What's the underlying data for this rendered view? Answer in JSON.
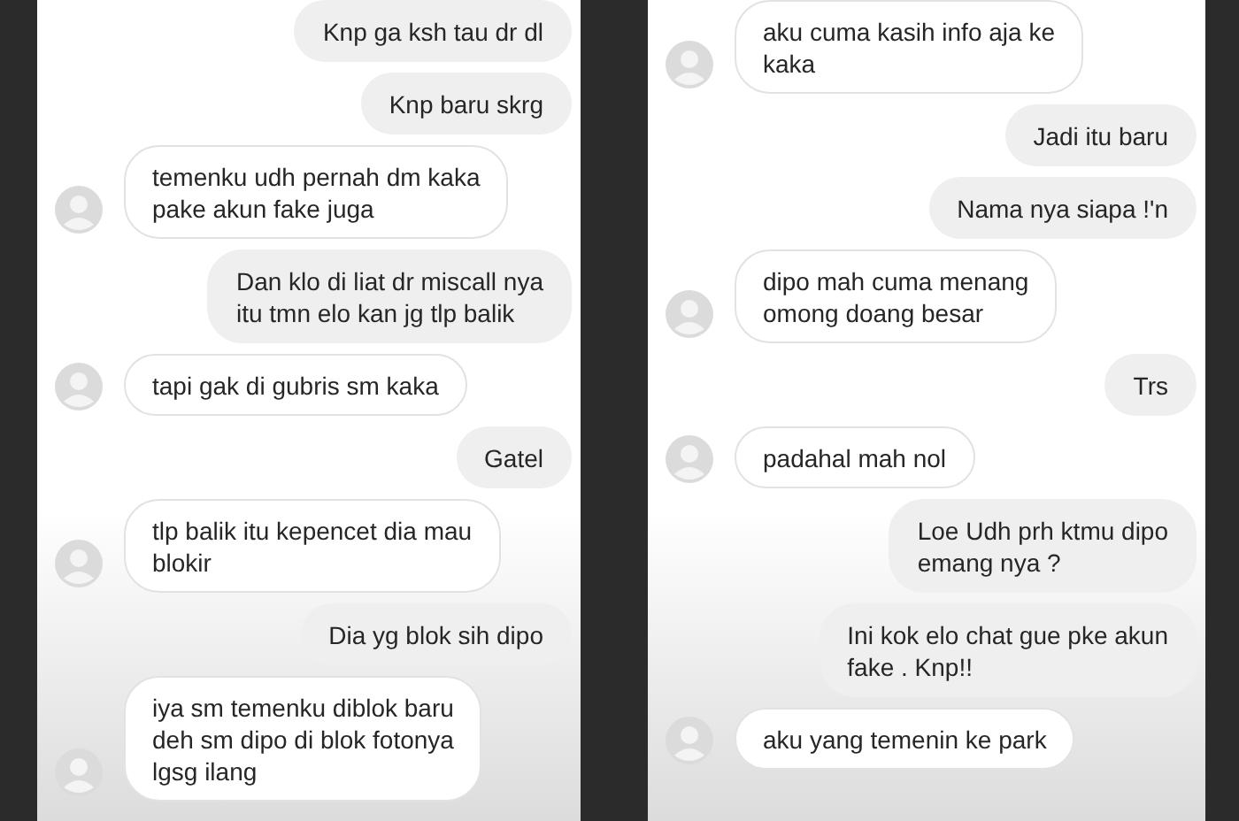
{
  "panels": [
    {
      "messages": [
        {
          "kind": "outgoing",
          "text": "Knp ga ksh tau dr dl"
        },
        {
          "kind": "outgoing",
          "text": "Knp baru skrg"
        },
        {
          "kind": "incoming",
          "text": "temenku udh pernah dm kaka\npake akun fake juga"
        },
        {
          "kind": "outgoing",
          "text": "Dan klo di liat dr miscall nya\nitu tmn elo kan jg tlp balik"
        },
        {
          "kind": "incoming",
          "text": "tapi gak di gubris sm kaka"
        },
        {
          "kind": "outgoing",
          "text": "Gatel"
        },
        {
          "kind": "incoming",
          "text": "tlp balik itu kepencet dia mau\nblokir"
        },
        {
          "kind": "outgoing",
          "text": "Dia yg blok sih dipo"
        },
        {
          "kind": "incoming",
          "text": "iya sm temenku diblok baru\ndeh sm dipo di blok fotonya\nlgsg ilang"
        }
      ]
    },
    {
      "messages": [
        {
          "kind": "incoming",
          "text": "aku cuma kasih info aja ke\nkaka"
        },
        {
          "kind": "outgoing",
          "text": "Jadi itu baru"
        },
        {
          "kind": "outgoing",
          "text": "Nama nya siapa !'n"
        },
        {
          "kind": "incoming",
          "text": "dipo mah cuma menang\nomong doang besar"
        },
        {
          "kind": "outgoing",
          "text": "Trs"
        },
        {
          "kind": "incoming",
          "text": "padahal mah nol"
        },
        {
          "kind": "outgoing",
          "text": "Loe Udh prh ktmu dipo\nemang nya ?"
        },
        {
          "kind": "outgoing",
          "text": "Ini kok elo chat gue pke akun\nfake . Knp!!"
        },
        {
          "kind": "incoming",
          "text": "aku yang temenin ke park"
        }
      ]
    }
  ]
}
